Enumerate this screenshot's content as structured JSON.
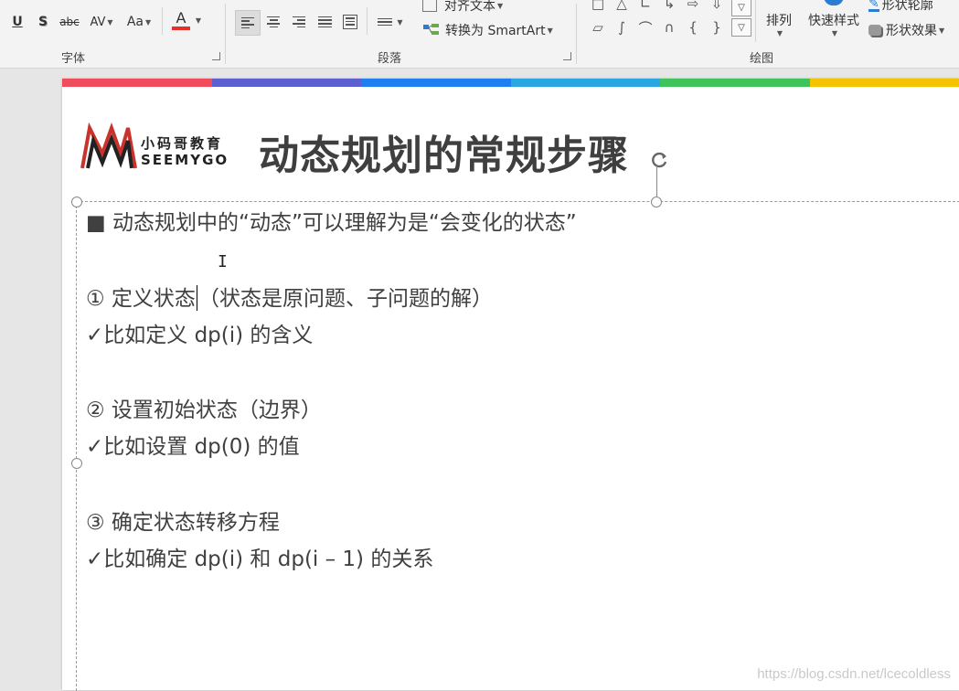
{
  "ribbon": {
    "groups": {
      "font": "字体",
      "paragraph": "段落",
      "drawing": "绘图"
    },
    "font_buttons": {
      "underline": "U",
      "shadow": "S",
      "strike": "abc",
      "spacing": "AV",
      "case": "Aa",
      "color": "A"
    },
    "align_text": "对齐文本",
    "smartart": "转换为 SmartArt",
    "arrange": "排列",
    "quick_styles": "快速样式",
    "shape_outline": "形状轮廓",
    "shape_effects": "形状效果",
    "accent_red": "#e8302a"
  },
  "slide": {
    "topbar_colors": [
      "#f04c5c",
      "#5b5fd0",
      "#1f7ff0",
      "#2aa6e0",
      "#3ec45a",
      "#f5c400"
    ],
    "logo": {
      "cn": "小码哥教育",
      "en": "SEEMYGO"
    },
    "title": "动态规划的常规步骤",
    "lines": [
      "■ 动态规划中的“动态”可以理解为是“会变化的状态”",
      "① 定义状态",
      "（状态是原问题、子问题的解）",
      "✓比如定义 dp(i) 的含义",
      "② 设置初始状态（边界）",
      "✓比如设置 dp(0) 的值",
      "③ 确定状态转移方程",
      "✓比如确定 dp(i) 和 dp(i – 1) 的关系"
    ]
  },
  "watermark": "https://blog.csdn.net/lcecoldless"
}
